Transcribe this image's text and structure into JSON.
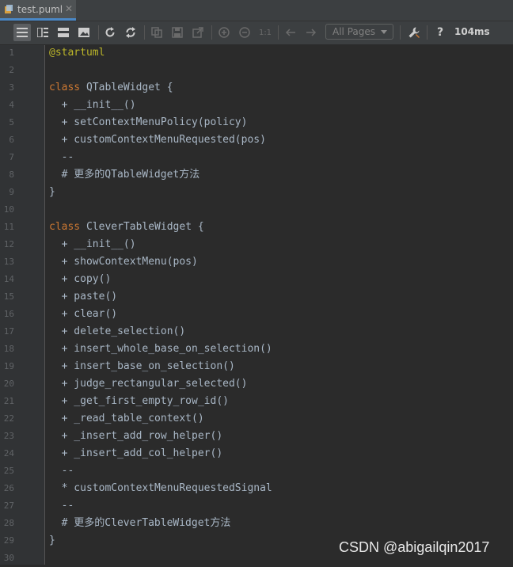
{
  "tab": {
    "filename": "test.puml",
    "close": "✕"
  },
  "toolbar": {
    "pages_label": "All Pages",
    "help_label": "?",
    "timing": "104ms",
    "zoom_label": "1:1"
  },
  "code": [
    {
      "n": "1",
      "t": "@startuml",
      "k": "anno"
    },
    {
      "n": "2",
      "t": ""
    },
    {
      "n": "3",
      "t": "QTableWidget {",
      "kw": "class"
    },
    {
      "n": "4",
      "t": "  + __init__()"
    },
    {
      "n": "5",
      "t": "  + setContextMenuPolicy(policy)"
    },
    {
      "n": "6",
      "t": "  + customContextMenuRequested(pos)"
    },
    {
      "n": "7",
      "t": "  --"
    },
    {
      "n": "8",
      "t": "  # 更多的QTableWidget方法"
    },
    {
      "n": "9",
      "t": "}"
    },
    {
      "n": "10",
      "t": ""
    },
    {
      "n": "11",
      "t": "CleverTableWidget {",
      "kw": "class"
    },
    {
      "n": "12",
      "t": "  + __init__()"
    },
    {
      "n": "13",
      "t": "  + showContextMenu(pos)"
    },
    {
      "n": "14",
      "t": "  + copy()"
    },
    {
      "n": "15",
      "t": "  + paste()"
    },
    {
      "n": "16",
      "t": "  + clear()"
    },
    {
      "n": "17",
      "t": "  + delete_selection()"
    },
    {
      "n": "18",
      "t": "  + insert_whole_base_on_selection()"
    },
    {
      "n": "19",
      "t": "  + insert_base_on_selection()"
    },
    {
      "n": "20",
      "t": "  + judge_rectangular_selected()"
    },
    {
      "n": "21",
      "t": "  + _get_first_empty_row_id()"
    },
    {
      "n": "22",
      "t": "  + _read_table_context()"
    },
    {
      "n": "23",
      "t": "  + _insert_add_row_helper()"
    },
    {
      "n": "24",
      "t": "  + _insert_add_col_helper()"
    },
    {
      "n": "25",
      "t": "  --"
    },
    {
      "n": "26",
      "t": "  * customContextMenuRequestedSignal"
    },
    {
      "n": "27",
      "t": "  --"
    },
    {
      "n": "28",
      "t": "  # 更多的CleverTableWidget方法"
    },
    {
      "n": "29",
      "t": "}"
    },
    {
      "n": "30",
      "t": ""
    }
  ],
  "watermark": "CSDN @abigailqin2017"
}
